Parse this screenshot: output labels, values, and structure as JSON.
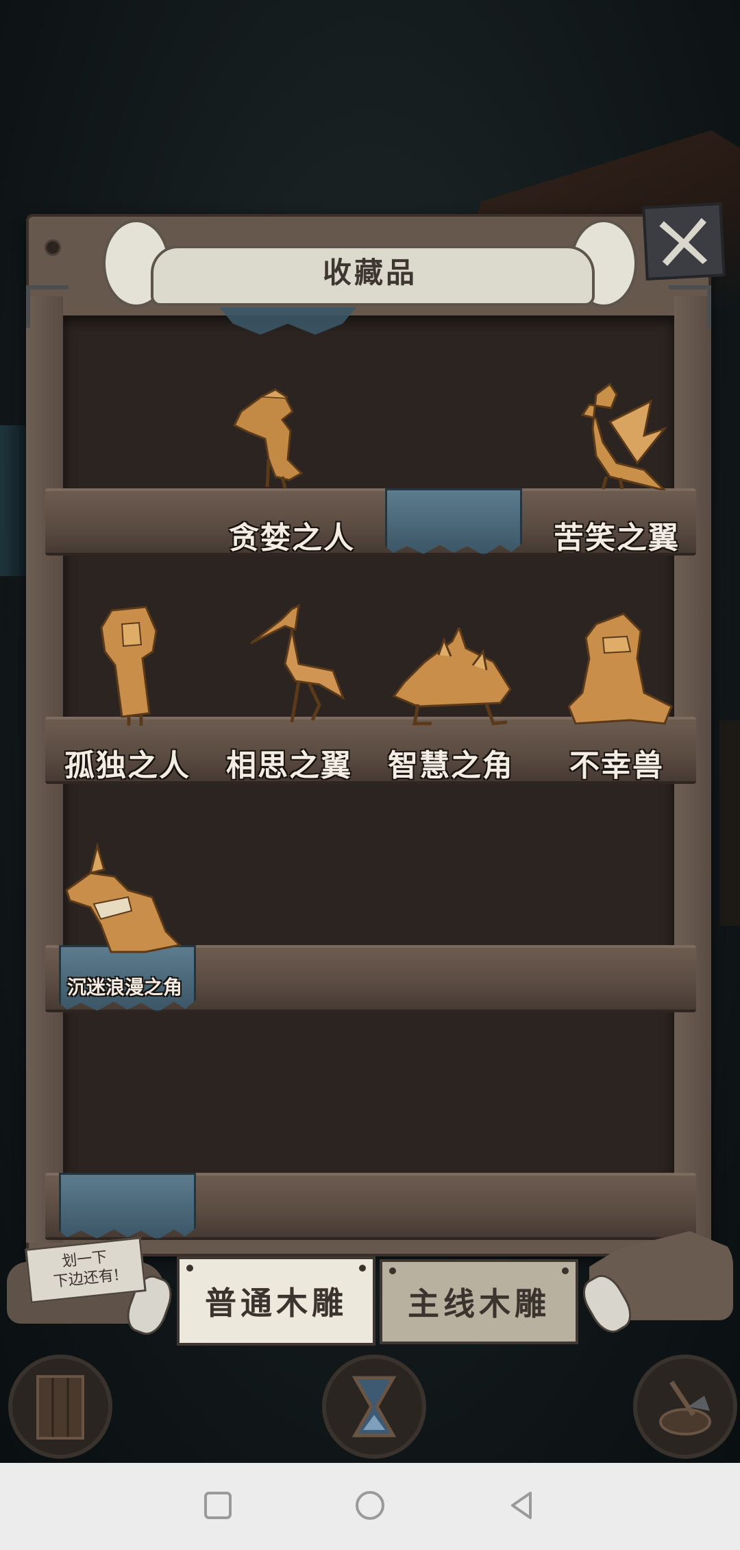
{
  "header": {
    "title": "收藏品"
  },
  "shelves": [
    {
      "items": [
        {
          "name": "贪婪之人",
          "icon": "greedy-man-figurine"
        },
        {
          "name": "",
          "icon": "blue-cloth-empty"
        },
        {
          "name": "苦笑之翼",
          "icon": "bird-figurine"
        }
      ]
    },
    {
      "items": [
        {
          "name": "孤独之人",
          "icon": "girl-figurine"
        },
        {
          "name": "相思之翼",
          "icon": "crane-figurine"
        },
        {
          "name": "智慧之角",
          "icon": "turtle-figurine"
        },
        {
          "name": "不幸兽",
          "icon": "seal-figurine"
        }
      ]
    },
    {
      "items": [
        {
          "name": "沉迷浪漫之角",
          "icon": "horned-dog-figurine"
        }
      ]
    }
  ],
  "hint_note": {
    "line1": "划一下",
    "line2": "下边还有!"
  },
  "tabs": [
    {
      "label": "普通木雕",
      "active": true
    },
    {
      "label": "主线木雕",
      "active": false
    }
  ],
  "bottom_buttons": [
    "door-icon",
    "hourglass-icon",
    "axe-stump-icon"
  ],
  "colors": {
    "wood": "#67584d",
    "cloth": "#4a6b7d",
    "label": "#f2ece3",
    "paper": "#ece8dc"
  }
}
